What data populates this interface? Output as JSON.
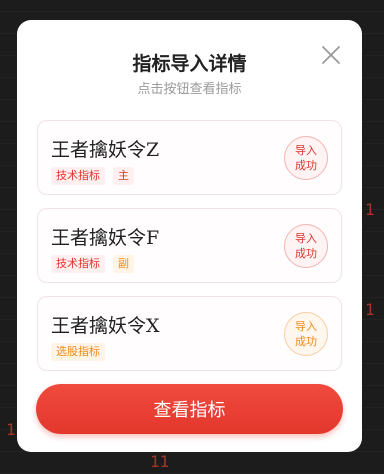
{
  "modal": {
    "title": "指标导入详情",
    "subtitle": "点击按钮查看指标"
  },
  "cards": [
    {
      "title": "王者擒妖令Z",
      "tags": [
        {
          "label": "技术指标",
          "color": "red"
        },
        {
          "label": "主",
          "color": "red"
        }
      ],
      "status_line1": "导入",
      "status_line2": "成功",
      "status_color": "red"
    },
    {
      "title": "王者擒妖令F",
      "tags": [
        {
          "label": "技术指标",
          "color": "red"
        },
        {
          "label": "副",
          "color": "orange"
        }
      ],
      "status_line1": "导入",
      "status_line2": "成功",
      "status_color": "red"
    },
    {
      "title": "王者擒妖令X",
      "tags": [
        {
          "label": "选股指标",
          "color": "orange"
        }
      ],
      "status_line1": "导入",
      "status_line2": "成功",
      "status_color": "orange"
    }
  ],
  "primary_button": {
    "label": "查看指标"
  },
  "background": {
    "digits": [
      "11",
      "1",
      "1",
      "11"
    ]
  },
  "colors": {
    "accent": "#e3372c",
    "orange": "#f08a1e"
  },
  "icons": {
    "close": "close-icon"
  }
}
